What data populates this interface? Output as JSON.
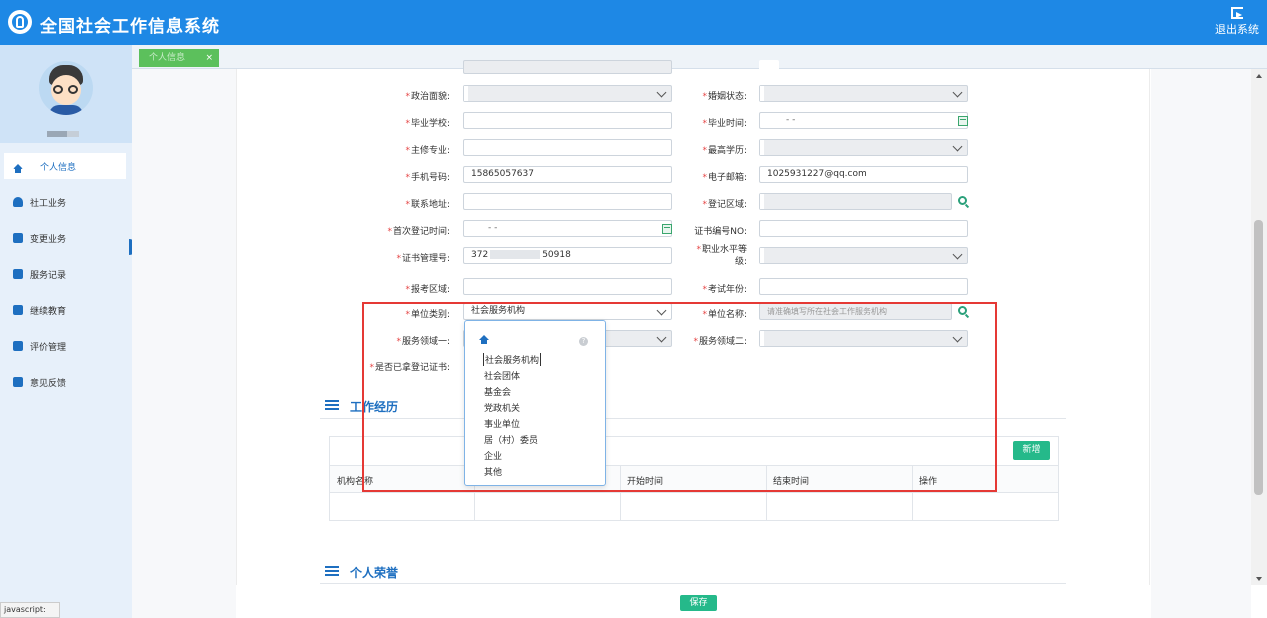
{
  "app": {
    "title": "全国社会工作信息系统",
    "logout_label": "退出系统"
  },
  "tab": {
    "label": "个人信息",
    "close": "×"
  },
  "sidebar": {
    "items": [
      {
        "label": "个人信息",
        "icon": "home-icon"
      },
      {
        "label": "社工业务",
        "icon": "user-icon"
      },
      {
        "label": "变更业务",
        "icon": "building-icon"
      },
      {
        "label": "服务记录",
        "icon": "record-icon"
      },
      {
        "label": "继续教育",
        "icon": "education-icon"
      },
      {
        "label": "评价管理",
        "icon": "list-icon"
      },
      {
        "label": "意见反馈",
        "icon": "feedback-icon"
      }
    ]
  },
  "status_bar": "javascript:",
  "form": {
    "required_mark": "*",
    "political_label": "政治面貌:",
    "marital_label": "婚姻状态:",
    "school_label": "毕业学校:",
    "grad_time_label": "毕业时间:",
    "grad_time_value": "-   -",
    "major_label": "主修专业:",
    "education_label": "最高学历:",
    "phone_label": "手机号码:",
    "phone_value": "15865057637",
    "email_label": "电子邮箱:",
    "email_value": "1025931227@qq.com",
    "address_label": "联系地址:",
    "region_label": "登记区域:",
    "first_reg_label": "首次登记时间:",
    "first_reg_value": "-   -",
    "cert_no_label": "证书编号NO:",
    "cert_mgmt_label": "证书管理号:",
    "cert_mgmt_value_a": "372",
    "cert_mgmt_value_b": "50918",
    "level_label_1": "职业水平等",
    "level_label_2": "级:",
    "exam_region_label": "报考区域:",
    "exam_year_label": "考试年份:",
    "unit_type_label": "单位类别:",
    "unit_type_value": "社会服务机构",
    "unit_name_label": "单位名称:",
    "unit_name_placeholder": "请准确填写所在社会工作服务机构",
    "service_area1_label": "服务领域一:",
    "service_area2_label": "服务领域二:",
    "has_cert_label": "是否已拿登记证书:"
  },
  "dropdown": {
    "help": "?",
    "options": [
      "社会服务机构",
      "社会团体",
      "基金会",
      "党政机关",
      "事业单位",
      "居（村）委员",
      "企业",
      "其他"
    ]
  },
  "work_history": {
    "title": "工作经历",
    "add_label": "新增",
    "columns": [
      "机构名称",
      "开始时间",
      "结束时间",
      "操作"
    ]
  },
  "honors": {
    "title": "个人荣誉"
  },
  "save_label": "保存"
}
